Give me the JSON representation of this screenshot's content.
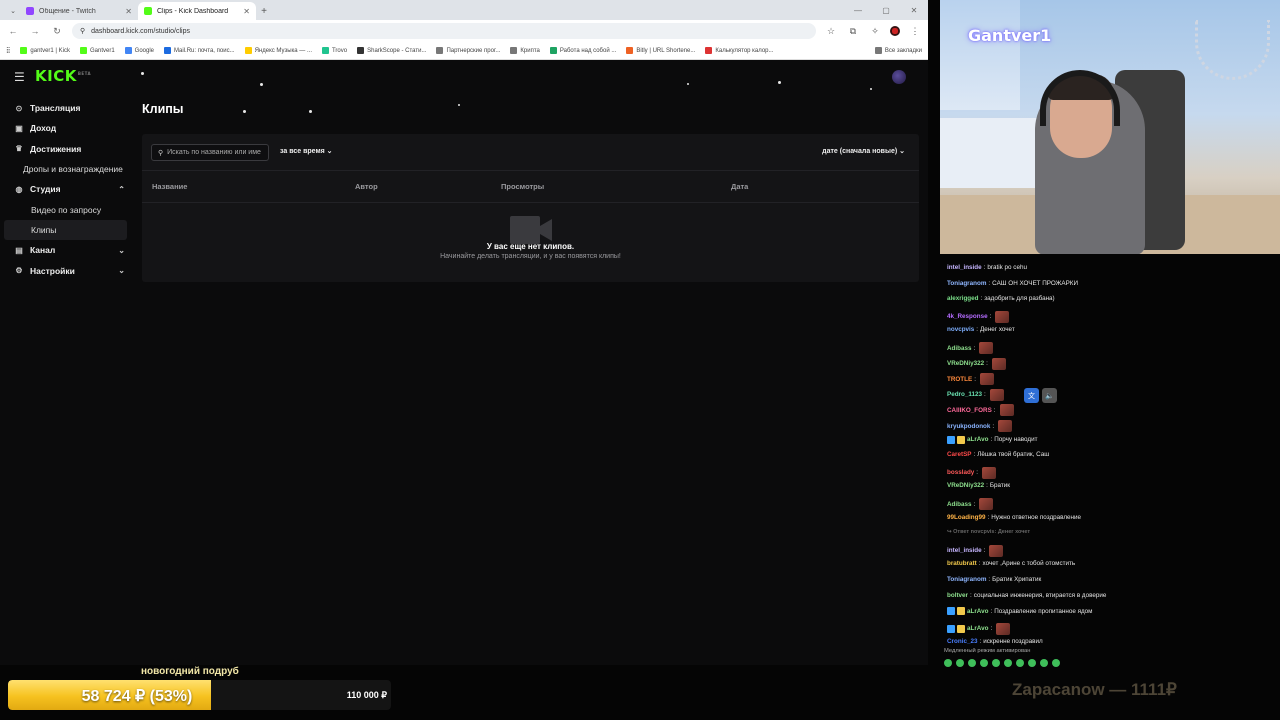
{
  "browser": {
    "tabs": [
      {
        "title": "Общение - Twitch",
        "favicon_color": "#9146ff",
        "active": false
      },
      {
        "title": "Clips - Kick Dashboard",
        "favicon_color": "#53fc18",
        "active": true
      }
    ],
    "url": "dashboard.kick.com/studio/clips",
    "bookmarks": [
      "gantver1 | Kick",
      "Gantver1",
      "Google",
      "Mail.Ru: почта, поис...",
      "Яндекс Музыка — ...",
      "Trovo",
      "SharkScope - Стати...",
      "Партнерские прог...",
      "Крипта",
      "Работа над собой ...",
      "Bitly | URL Shortene...",
      "Калькулятор калор..."
    ],
    "bookmarks_right": "Все закладки"
  },
  "kick": {
    "logo": "KICK",
    "logo_beta": "BETA",
    "sidebar": [
      {
        "label": "Трансляция",
        "icon": "broadcast-icon",
        "icon_glyph": "⊙",
        "level": 0
      },
      {
        "label": "Доход",
        "icon": "income-icon",
        "icon_glyph": "▣",
        "level": 0
      },
      {
        "label": "Достижения",
        "icon": "trophy-icon",
        "icon_glyph": "♛",
        "level": 0
      },
      {
        "label": "Дропы и вознаграждение",
        "icon": "",
        "icon_glyph": "",
        "level": 2
      },
      {
        "label": "Студия",
        "icon": "studio-icon",
        "icon_glyph": "◍",
        "level": 0,
        "chevron": "⌃"
      },
      {
        "label": "Видео по запросу",
        "icon": "",
        "icon_glyph": "",
        "level": 1
      },
      {
        "label": "Клипы",
        "icon": "",
        "icon_glyph": "",
        "level": 1,
        "active": true
      },
      {
        "label": "Канал",
        "icon": "channel-icon",
        "icon_glyph": "▤",
        "level": 0,
        "chevron": "⌄"
      },
      {
        "label": "Настройки",
        "icon": "settings-icon",
        "icon_glyph": "⚙",
        "level": 0,
        "chevron": "⌄"
      }
    ],
    "page_title": "Клипы",
    "search_placeholder": "Искать по названию или име",
    "period_filter": "за все время ⌄",
    "sort": "дате (сначала новые) ⌄",
    "columns": [
      "Название",
      "Автор",
      "Просмотры",
      "Дата"
    ],
    "empty_title": "У вас еще нет клипов.",
    "empty_subtitle": "Начинайте делать трансляции, и у вас появятся клипы!"
  },
  "webcam": {
    "overlay_name": "Gantver1"
  },
  "chat": {
    "messages": [
      {
        "user": "intel_inside",
        "color": "#c6b6ff",
        "text": "bratik po cehu",
        "emote": false
      },
      {
        "user": "Toniagranom",
        "color": "#8fb6ff",
        "text": "САШ ОН ХОЧЕТ ПРОЖАРКИ",
        "emote": false
      },
      {
        "user": "alexrigged",
        "color": "#7be08a",
        "text": "задобрить для разбана)",
        "emote": false
      },
      {
        "user": "4k_Response",
        "color": "#b56cff",
        "text": "",
        "emote": true
      },
      {
        "user": "novcpvis",
        "color": "#7fb0ff",
        "text": "Денег хочет",
        "emote": false
      },
      {
        "user": "Adibass",
        "color": "#8ee08e",
        "text": "",
        "emote": true
      },
      {
        "user": "VReDNiy322",
        "color": "#8ee08e",
        "text": "",
        "emote": true
      },
      {
        "user": "TROTLE",
        "color": "#ff8a3d",
        "text": "",
        "emote": true
      },
      {
        "user": "Pedro_1123",
        "color": "#69e0b0",
        "text": "",
        "emote": true
      },
      {
        "user": "CAIIIKO_FORS",
        "color": "#ff6a9a",
        "text": "",
        "emote": true
      },
      {
        "user": "kryukpodonok",
        "color": "#8ab4ff",
        "text": "",
        "emote": true
      },
      {
        "user": "aLrAvo",
        "color": "#8ee08e",
        "text": "Порчу наводит",
        "emote": false,
        "badges": true
      },
      {
        "user": "CaretSP",
        "color": "#ff4a4a",
        "text": "Лёшка твой братик, Саш",
        "emote": false
      },
      {
        "user": "bosslady",
        "color": "#ff5a5a",
        "text": "",
        "emote": true
      },
      {
        "user": "VReDNiy322",
        "color": "#8ee08e",
        "text": "Братик",
        "emote": false
      },
      {
        "user": "Adibass",
        "color": "#8ee08e",
        "text": "",
        "emote": true
      },
      {
        "user": "99Loading99",
        "color": "#ffb347",
        "text": "Нужно ответное поздравление",
        "emote": false
      },
      {
        "user": "↪ Ответ novcpvis: Денег хочет",
        "color": "#666666",
        "text": "",
        "emote": false,
        "reply": true
      },
      {
        "user": "intel_inside",
        "color": "#c6b6ff",
        "text": "",
        "emote": true
      },
      {
        "user": "bratubratt",
        "color": "#f2c94c",
        "text": "хочет ,Арине с тобой отомстить",
        "emote": false
      },
      {
        "user": "Toniagranom",
        "color": "#8fb6ff",
        "text": "Братик Хрипатик",
        "emote": false
      },
      {
        "user": "boltver",
        "color": "#8ee08e",
        "text": "социальная инженерия, втирается в доверие",
        "emote": false
      },
      {
        "user": "aLrAvo",
        "color": "#8ee08e",
        "text": "Поздравление пропитанное ядом",
        "emote": false,
        "badges": true
      },
      {
        "user": "aLrAvo",
        "color": "#8ee08e",
        "text": "",
        "emote": true,
        "badges": true
      },
      {
        "user": "Cronic_23",
        "color": "#4a7fff",
        "text": "искренне поздравил",
        "emote": false
      }
    ],
    "slow_mode": "Медленный режим активирован"
  },
  "donation": {
    "title": "новогодний подруб",
    "current_label": "58 724 ₽ (53%)",
    "progress": 0.53,
    "goal": "110 000 ₽",
    "top_donor": "Zapacanow — 1111₽"
  }
}
